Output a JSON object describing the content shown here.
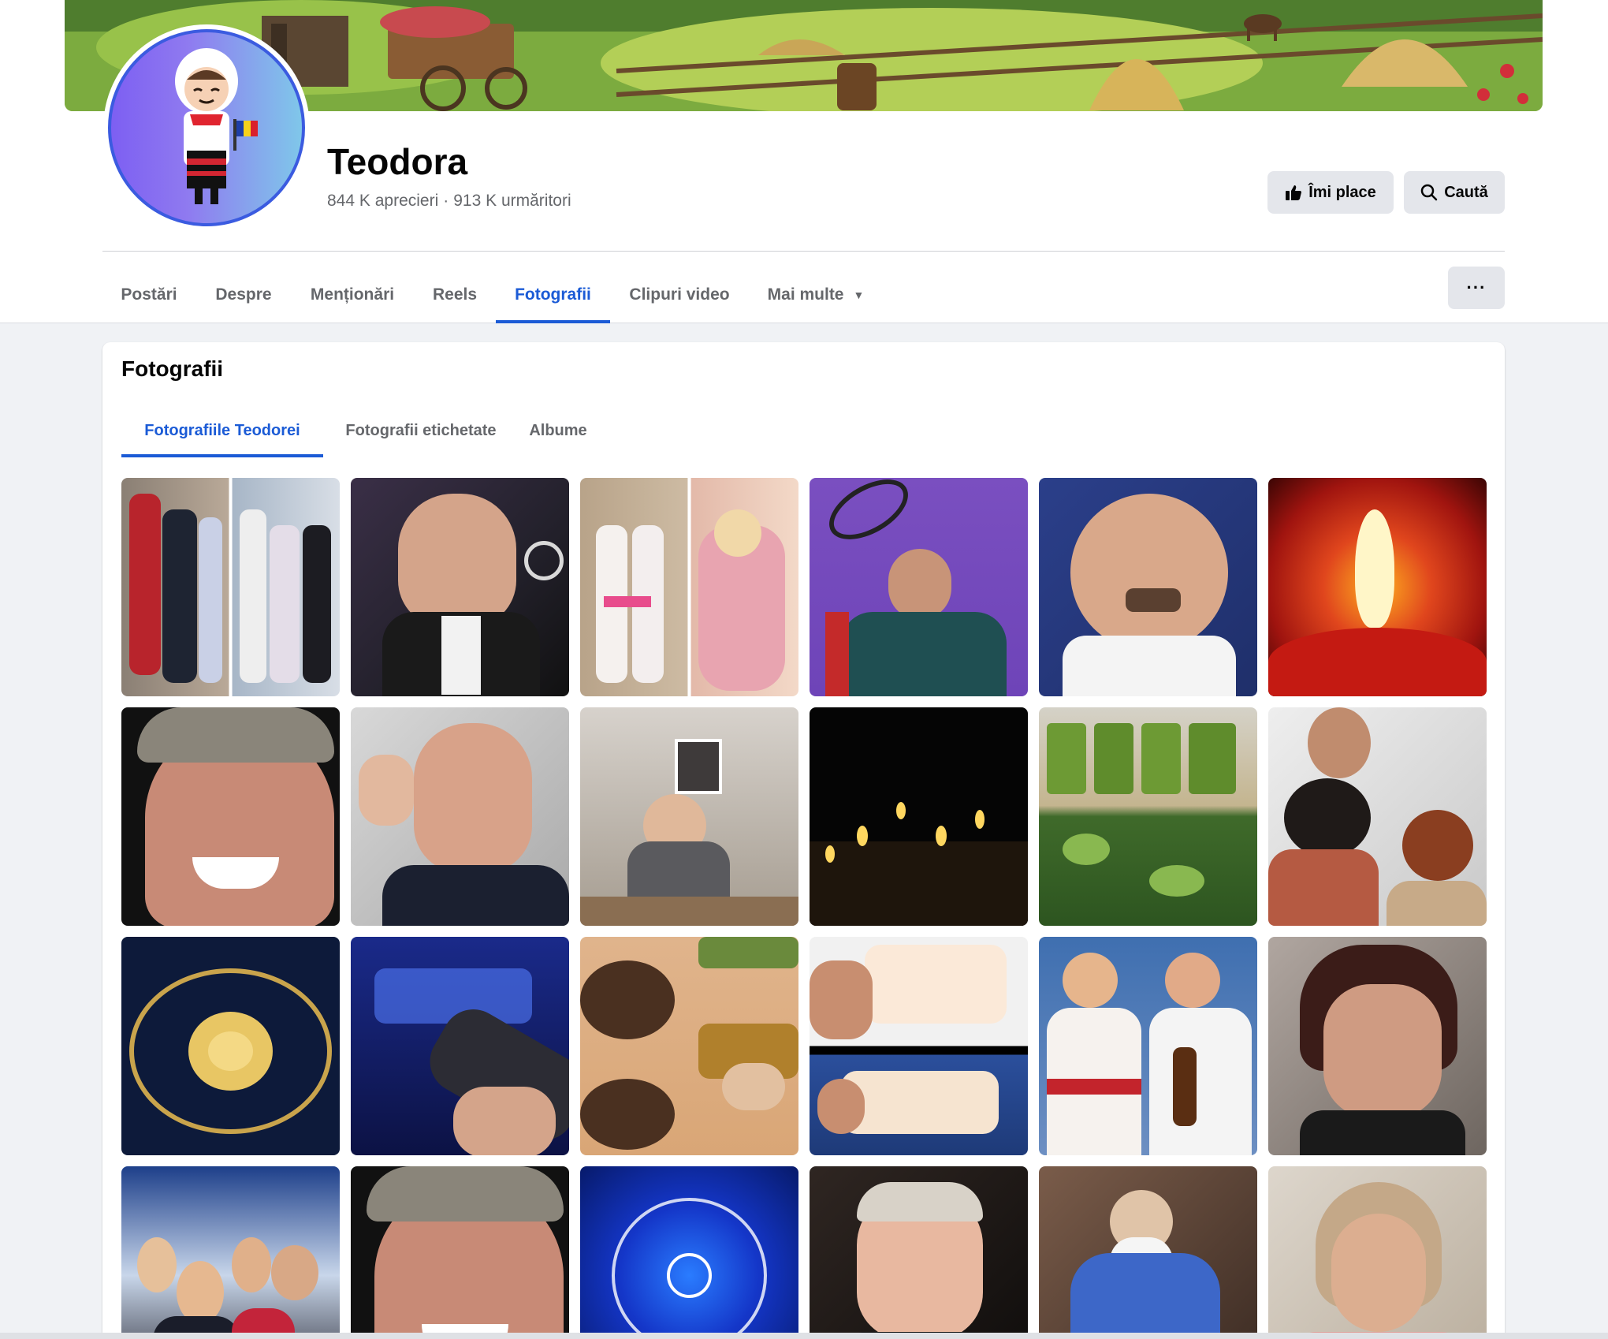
{
  "profile": {
    "name": "Teodora",
    "likes": "844 K aprecieri",
    "separator": "·",
    "followers": "913 K urmăritori"
  },
  "actions": {
    "like_label": "Îmi place",
    "search_label": "Caută",
    "more_label": "···"
  },
  "nav": {
    "tabs": [
      "Postări",
      "Despre",
      "Menționări",
      "Reels",
      "Fotografii",
      "Clipuri video",
      "Mai multe"
    ],
    "active": "Fotografii"
  },
  "photos": {
    "title": "Fotografii",
    "subtabs": [
      "Fotografiile Teodorei",
      "Fotografii etichetate",
      "Albume"
    ],
    "active_subtab": "Fotografiile Teodorei"
  },
  "colors": {
    "accent": "#1b5bd6",
    "button_bg": "#e4e6eb",
    "page_bg": "#f0f2f5"
  }
}
